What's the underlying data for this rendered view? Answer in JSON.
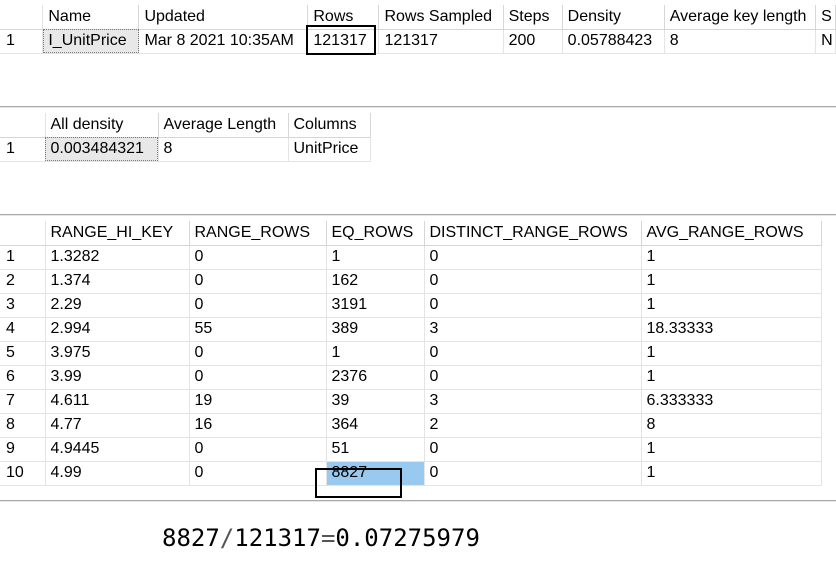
{
  "stats_header": {
    "columns": [
      "Name",
      "Updated",
      "Rows",
      "Rows Sampled",
      "Steps",
      "Density",
      "Average key length",
      "S"
    ],
    "rows": [
      {
        "row_num": "1",
        "cells": [
          "I_UnitPrice",
          "Mar  8 2021 10:35AM",
          "121317",
          "121317",
          "200",
          "0.05788423",
          "8",
          "N"
        ]
      }
    ]
  },
  "density_vector": {
    "columns": [
      "All density",
      "Average Length",
      "Columns"
    ],
    "rows": [
      {
        "row_num": "1",
        "cells": [
          "0.003484321",
          "8",
          "UnitPrice"
        ]
      }
    ]
  },
  "histogram": {
    "columns": [
      "RANGE_HI_KEY",
      "RANGE_ROWS",
      "EQ_ROWS",
      "DISTINCT_RANGE_ROWS",
      "AVG_RANGE_ROWS"
    ],
    "rows": [
      {
        "row_num": "1",
        "cells": [
          "1.3282",
          "0",
          "1",
          "0",
          "1"
        ]
      },
      {
        "row_num": "2",
        "cells": [
          "1.374",
          "0",
          "162",
          "0",
          "1"
        ]
      },
      {
        "row_num": "3",
        "cells": [
          "2.29",
          "0",
          "3191",
          "0",
          "1"
        ]
      },
      {
        "row_num": "4",
        "cells": [
          "2.994",
          "55",
          "389",
          "3",
          "18.33333"
        ]
      },
      {
        "row_num": "5",
        "cells": [
          "3.975",
          "0",
          "1",
          "0",
          "1"
        ]
      },
      {
        "row_num": "6",
        "cells": [
          "3.99",
          "0",
          "2376",
          "0",
          "1"
        ]
      },
      {
        "row_num": "7",
        "cells": [
          "4.611",
          "19",
          "39",
          "3",
          "6.333333"
        ]
      },
      {
        "row_num": "8",
        "cells": [
          "4.77",
          "16",
          "364",
          "2",
          "8"
        ]
      },
      {
        "row_num": "9",
        "cells": [
          "4.9445",
          "0",
          "51",
          "0",
          "1"
        ]
      },
      {
        "row_num": "10",
        "cells": [
          "4.99",
          "0",
          "8827",
          "0",
          "1"
        ]
      }
    ]
  },
  "annotation": {
    "numerator": "8827",
    "divide": "/",
    "denominator": "121317",
    "equals": "=",
    "result": "0.07275979"
  },
  "colors": {
    "highlight": "#99c9ef",
    "selection_box": "#000000"
  }
}
